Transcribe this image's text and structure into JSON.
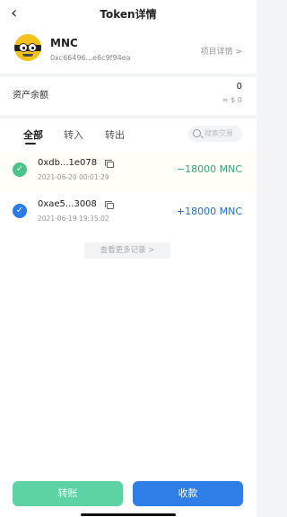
{
  "nav": {
    "back_icon": "back-arrow-icon",
    "title": "Token详情"
  },
  "token": {
    "symbol": "MNC",
    "address": "0xc66496...e6c9f94ea",
    "project_link": "项目详情 >"
  },
  "balance": {
    "label": "资产余额",
    "value": "0",
    "fiat": "≈ $ 0"
  },
  "tabs": [
    {
      "label": "全部",
      "active": true
    },
    {
      "label": "转入",
      "active": false
    },
    {
      "label": "转出",
      "active": false
    }
  ],
  "search": {
    "placeholder": "搜索交易"
  },
  "transactions": [
    {
      "hash": "0xdb...1e078",
      "time": "2021-06-20 00:01:29",
      "amount": "−18000 MNC",
      "direction": "out",
      "color": "#2fa77a"
    },
    {
      "hash": "0xae5...3008",
      "time": "2021-06-19 19:35:02",
      "amount": "+18000 MNC",
      "direction": "in",
      "color": "#1f6fd4"
    }
  ],
  "more_records": "查看更多记录 >",
  "actions": {
    "transfer": "转账",
    "receive": "收款"
  },
  "colors": {
    "transfer_button": "#5dd3a4",
    "receive_button": "#2f7de6"
  }
}
